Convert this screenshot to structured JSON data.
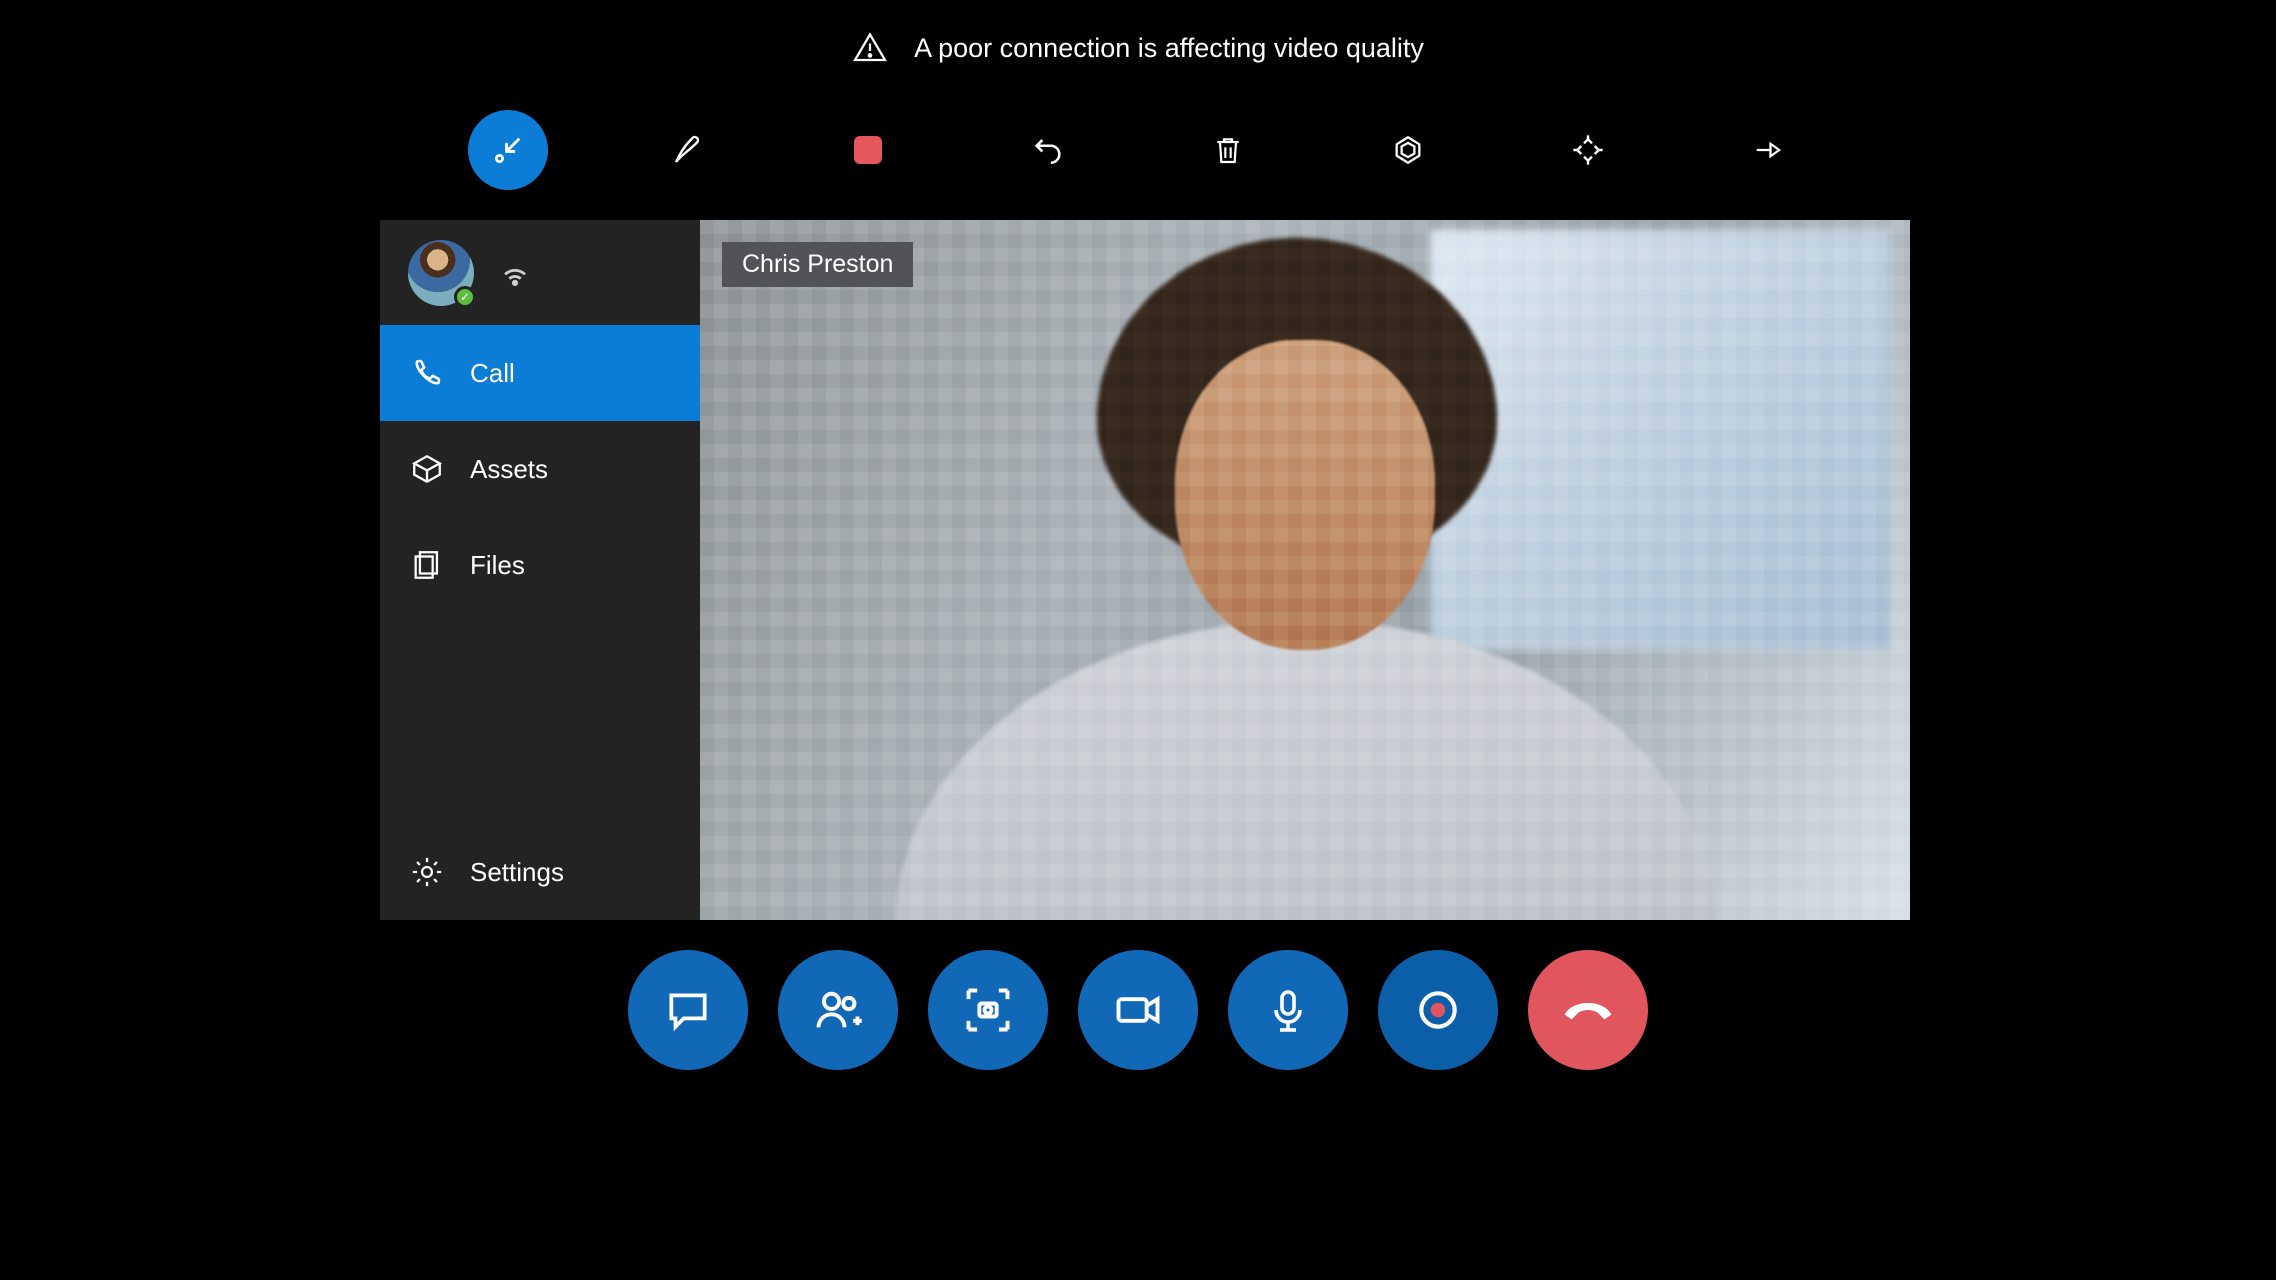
{
  "status": {
    "message": "A poor connection is affecting video quality"
  },
  "top_toolbar": {
    "items": [
      {
        "name": "collapse",
        "label": "",
        "active": true
      },
      {
        "name": "annotate",
        "label": ""
      },
      {
        "name": "record-stop",
        "label": ""
      },
      {
        "name": "undo",
        "label": ""
      },
      {
        "name": "delete",
        "label": ""
      },
      {
        "name": "tag",
        "label": ""
      },
      {
        "name": "expand",
        "label": ""
      },
      {
        "name": "pin",
        "label": ""
      }
    ]
  },
  "sidebar": {
    "items": [
      {
        "label": "Call",
        "icon": "phone",
        "selected": true
      },
      {
        "label": "Assets",
        "icon": "box",
        "selected": false
      },
      {
        "label": "Files",
        "icon": "files",
        "selected": false
      },
      {
        "label": "Settings",
        "icon": "gear",
        "selected": false
      }
    ]
  },
  "video": {
    "participant_name": "Chris Preston"
  },
  "call_bar": {
    "items": [
      {
        "name": "chat"
      },
      {
        "name": "add-participant"
      },
      {
        "name": "capture"
      },
      {
        "name": "camera"
      },
      {
        "name": "microphone"
      },
      {
        "name": "record"
      },
      {
        "name": "hang-up"
      }
    ]
  }
}
